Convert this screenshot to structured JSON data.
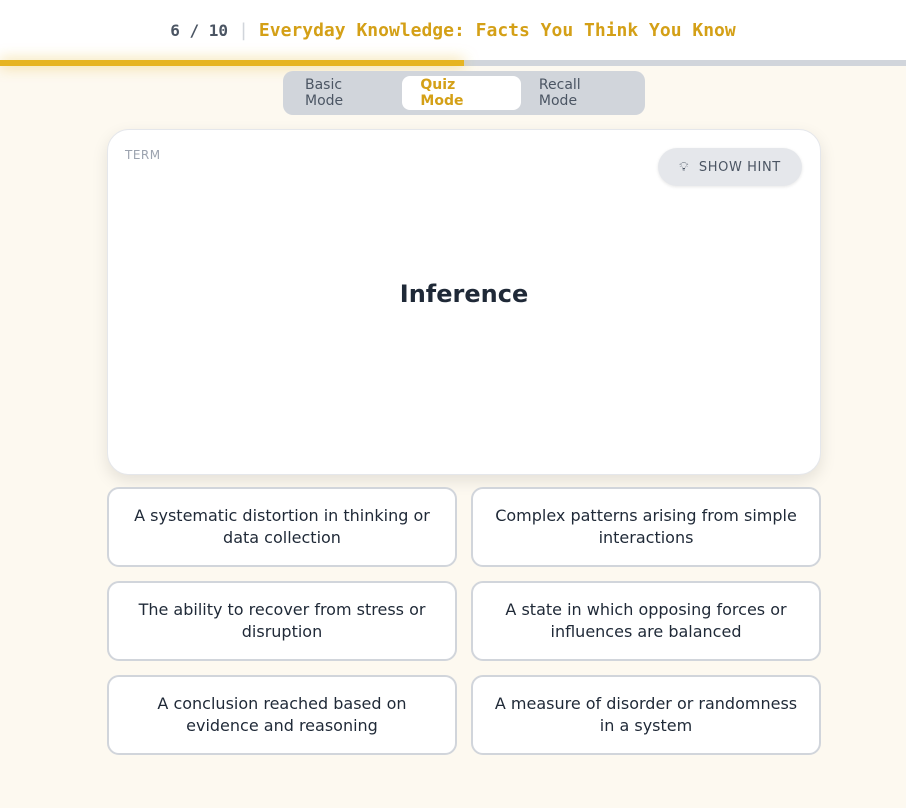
{
  "header": {
    "counter": "6 / 10",
    "separator": "|",
    "title": "Everyday Knowledge: Facts You Think You Know",
    "progress": 0.6
  },
  "modes": {
    "items": [
      {
        "label": "Basic Mode",
        "active": false
      },
      {
        "label": "Quiz Mode",
        "active": true
      },
      {
        "label": "Recall Mode",
        "active": false
      }
    ]
  },
  "card": {
    "label": "TERM",
    "hint_icon": "lightbulb-icon",
    "hint_label": "SHOW HINT",
    "term": "Inference"
  },
  "options": [
    {
      "text": "A systematic distortion in thinking or data collection"
    },
    {
      "text": "Complex patterns arising from simple interactions"
    },
    {
      "text": "The ability to recover from stress or disruption"
    },
    {
      "text": "A state in which opposing forces or influences are balanced"
    },
    {
      "text": "A conclusion reached based on evidence and reasoning"
    },
    {
      "text": "A measure of disorder or randomness in a system"
    }
  ],
  "colors": {
    "accent": "#d4a017",
    "progress": "#e6b422",
    "background": "#fdf9f0"
  }
}
